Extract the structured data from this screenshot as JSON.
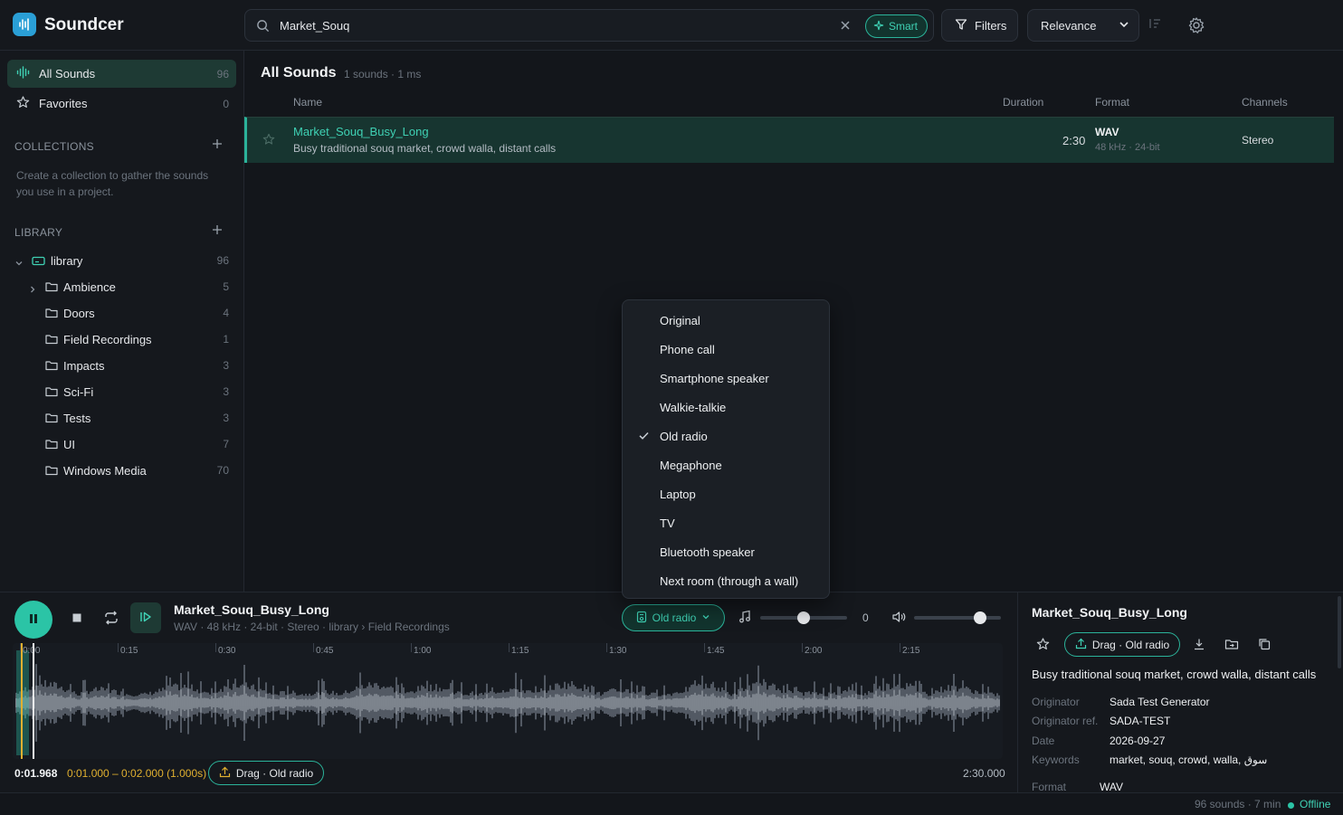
{
  "app": {
    "name": "Soundcer"
  },
  "search": {
    "value": "Market_Souq",
    "smart_label": "Smart"
  },
  "toolbar": {
    "filters_label": "Filters",
    "sort_value": "Relevance"
  },
  "sidebar": {
    "all_sounds": {
      "label": "All Sounds",
      "count": "96"
    },
    "favorites": {
      "label": "Favorites",
      "count": "0"
    },
    "collections_title": "COLLECTIONS",
    "collections_hint": "Create a collection to gather the sounds you use in a project.",
    "library_title": "LIBRARY",
    "library": {
      "label": "library",
      "count": "96"
    },
    "folders": [
      {
        "label": "Ambience",
        "count": "5"
      },
      {
        "label": "Doors",
        "count": "4"
      },
      {
        "label": "Field Recordings",
        "count": "1"
      },
      {
        "label": "Impacts",
        "count": "3"
      },
      {
        "label": "Sci-Fi",
        "count": "3"
      },
      {
        "label": "Tests",
        "count": "3"
      },
      {
        "label": "UI",
        "count": "7"
      },
      {
        "label": "Windows Media",
        "count": "70"
      }
    ]
  },
  "main": {
    "title": "All Sounds",
    "meta": "1 sounds · 1 ms",
    "columns": {
      "name": "Name",
      "duration": "Duration",
      "format": "Format",
      "channels": "Channels"
    },
    "rows": [
      {
        "name": "Market_Souq_Busy_Long",
        "description": "Busy traditional souq market, crowd walla, distant calls",
        "duration": "2:30",
        "format": "WAV",
        "format_detail": "48 kHz · 24-bit",
        "channels": "Stereo"
      }
    ]
  },
  "effect_menu": {
    "items": [
      "Original",
      "Phone call",
      "Smartphone speaker",
      "Walkie-talkie",
      "Old radio",
      "Megaphone",
      "Laptop",
      "TV",
      "Bluetooth speaker",
      "Next room (through a wall)"
    ],
    "selected": "Old radio"
  },
  "player": {
    "title": "Market_Souq_Busy_Long",
    "meta": "WAV · 48 kHz · 24-bit · Stereo · library › Field Recordings",
    "effect_label": "Old radio",
    "pitch_value": "0",
    "pitch_level": 0.5,
    "volume_level": 0.76,
    "progress_fraction": 0.013,
    "ticks": [
      "0:00",
      "0:15",
      "0:30",
      "0:45",
      "1:00",
      "1:15",
      "1:30",
      "1:45",
      "2:00",
      "2:15"
    ],
    "position": "0:01.968",
    "selection": "0:01.000 – 0:02.000 (1.000s)",
    "drag_label": "Drag · Old radio",
    "end_time": "2:30.000"
  },
  "details": {
    "title": "Market_Souq_Busy_Long",
    "drag_label": "Drag · Old radio",
    "description": "Busy traditional souq market, crowd walla, distant calls",
    "fields": [
      {
        "key": "Originator",
        "value": "Sada Test Generator"
      },
      {
        "key": "Originator ref.",
        "value": "SADA-TEST"
      },
      {
        "key": "Date",
        "value": "2026-09-27"
      },
      {
        "key": "Keywords",
        "value": "market, souq, crowd, walla, سوق"
      },
      {
        "key": "Format",
        "value": "WAV"
      }
    ]
  },
  "status": {
    "count": "96 sounds · 7 min",
    "connection": "Offline"
  },
  "colors": {
    "accent": "#2bc4a6",
    "accent_text": "#3fd1b4",
    "selection": "#e0b030",
    "background": "#13161b"
  }
}
